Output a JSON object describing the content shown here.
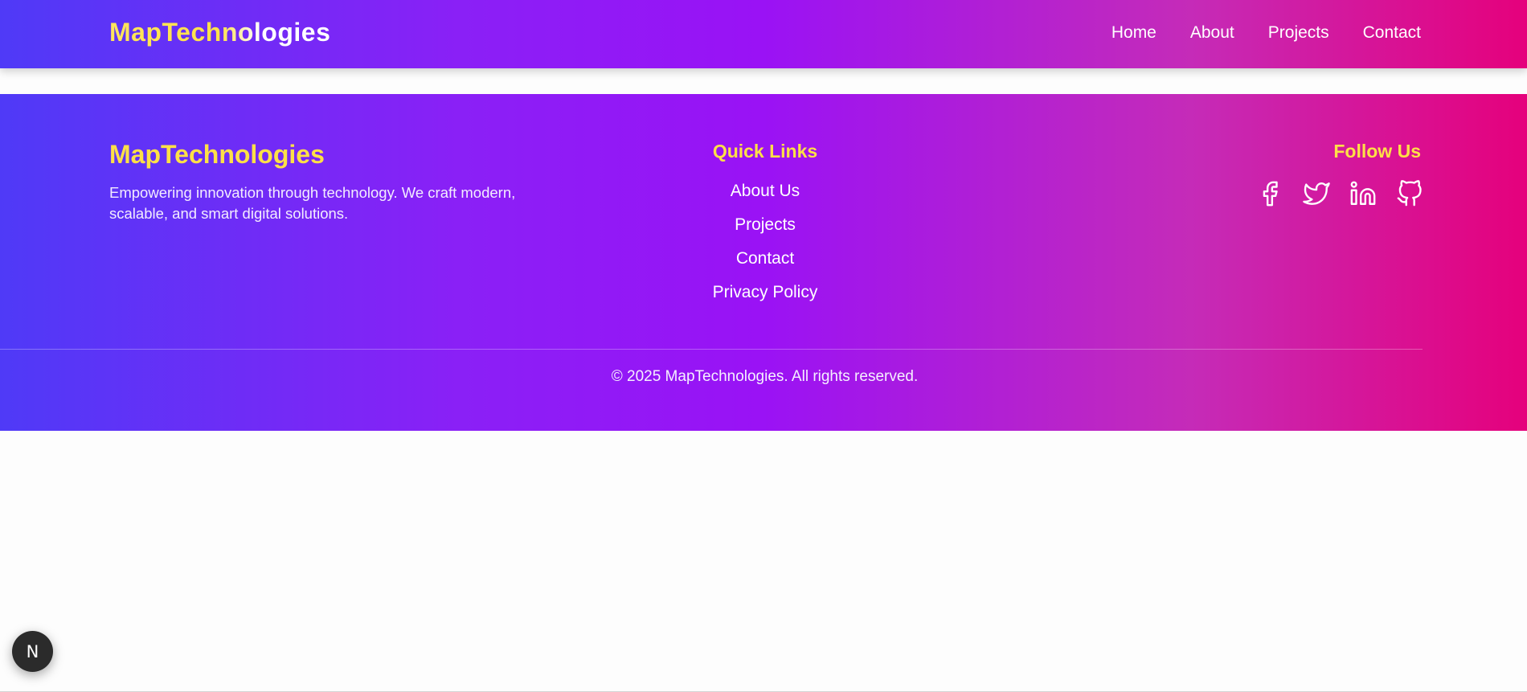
{
  "navbar": {
    "brand": "MapTechnologies",
    "links": [
      "Home",
      "About",
      "Projects",
      "Contact"
    ]
  },
  "footer": {
    "brand": "MapTechnologies",
    "description": "Empowering innovation through technology. We craft modern, scalable, and smart digital solutions.",
    "quick_links_title": "Quick Links",
    "quick_links": [
      "About Us",
      "Projects",
      "Contact",
      "Privacy Policy"
    ],
    "follow_title": "Follow Us",
    "socials": [
      "facebook-icon",
      "twitter-icon",
      "linkedin-icon",
      "github-icon"
    ],
    "copyright": "© 2025 MapTechnologies. All rights reserved."
  },
  "dev_badge": {
    "letter": "N"
  },
  "colors": {
    "gradient_start": "#4f3af7",
    "gradient_mid": "#9a12f5",
    "gradient_end": "#e5017c",
    "accent_yellow": "#fde047",
    "text_white": "#ffffff"
  }
}
